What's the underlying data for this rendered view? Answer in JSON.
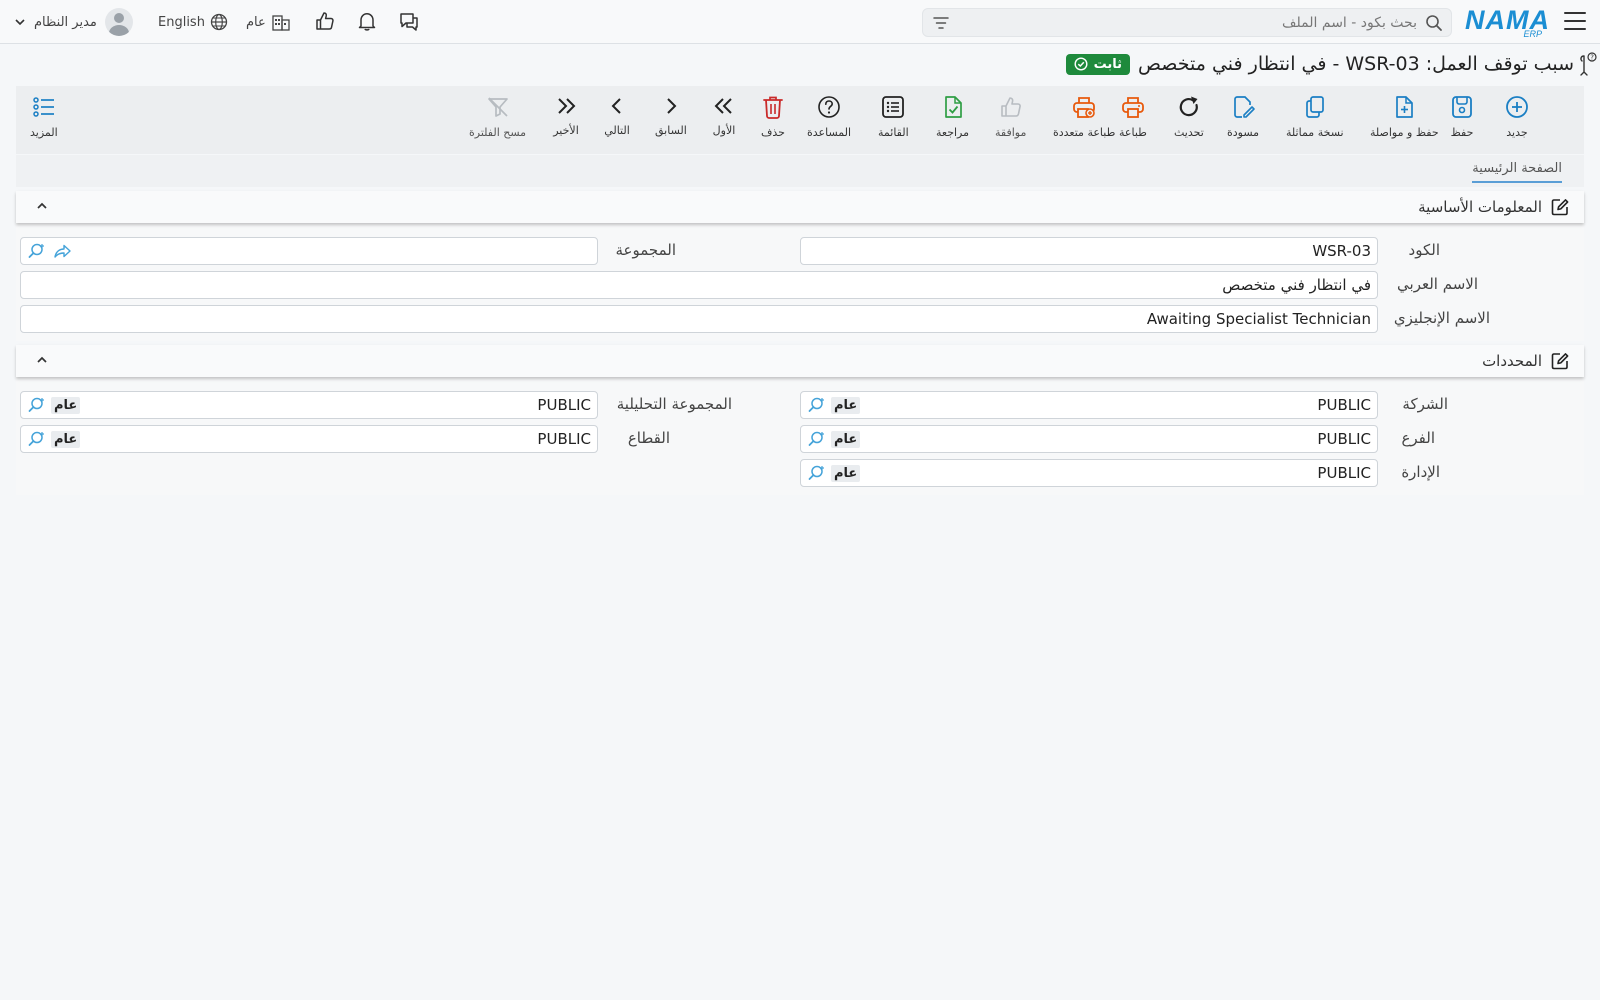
{
  "topbar": {
    "logo_text": "NAMA",
    "logo_sub": "ERP",
    "search_placeholder": "بحث بكود - اسم الملف",
    "user_name": "مدير النظام",
    "language": "English",
    "company": "عام"
  },
  "page": {
    "title": "سبب توقف العمل: WSR-03 - في انتظار فني متخصص",
    "status_badge": "ثابت",
    "status_color": "#1e8a3c"
  },
  "toolbar": {
    "new": "جديد",
    "save": "حفظ",
    "save_continue": "حفظ و مواصلة",
    "duplicate": "نسخة مماثلة",
    "draft": "مسودة",
    "refresh": "تحديث",
    "print": "طباعة",
    "multi_print": "طباعة متعددة",
    "approve": "موافقة",
    "review": "مراجعة",
    "list": "القائمة",
    "help": "المساعدة",
    "delete": "حذف",
    "first": "الأول",
    "previous": "السابق",
    "next": "التالي",
    "last": "الأخير",
    "clear_filter": "مسح الفلترة",
    "more": "المزيد"
  },
  "tabs": {
    "main": "الصفحة الرئيسية"
  },
  "basic_info": {
    "title": "المعلومات الأساسية",
    "code_label": "الكود",
    "code_value": "WSR-03",
    "group_label": "المجموعة",
    "group_value": "",
    "arabic_name_label": "الاسم العربي",
    "arabic_name_value": "في انتظار فني متخصص",
    "english_name_label": "الاسم الإنجليزي",
    "english_name_value": "Awaiting Specialist Technician"
  },
  "dimensions": {
    "title": "المحددات",
    "company_label": "الشركة",
    "company_value": "PUBLIC",
    "company_tag": "عام",
    "analytic_group_label": "المجموعة التحليلية",
    "analytic_group_value": "PUBLIC",
    "analytic_group_tag": "عام",
    "branch_label": "الفرع",
    "branch_value": "PUBLIC",
    "branch_tag": "عام",
    "sector_label": "القطاع",
    "sector_value": "PUBLIC",
    "sector_tag": "عام",
    "department_label": "الإدارة",
    "department_value": "PUBLIC",
    "department_tag": "عام"
  }
}
